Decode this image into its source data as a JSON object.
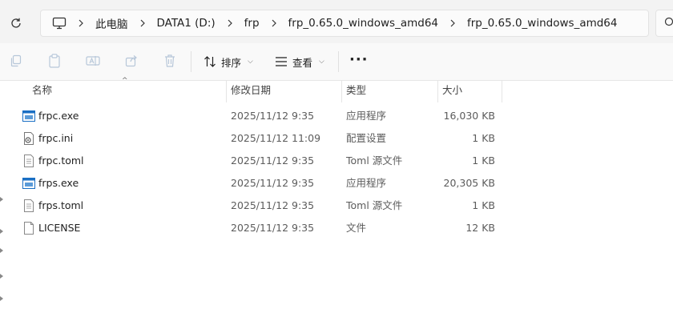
{
  "address": {
    "crumbs": [
      "此电脑",
      "DATA1 (D:)",
      "frp",
      "frp_0.65.0_windows_amd64",
      "frp_0.65.0_windows_amd64"
    ]
  },
  "toolbar": {
    "sort_label": "排序",
    "view_label": "查看",
    "more_label": "···"
  },
  "columns": {
    "name": "名称",
    "modified": "修改日期",
    "type": "类型",
    "size": "大小"
  },
  "files": [
    {
      "name": "frpc.exe",
      "modified": "2025/11/12 9:35",
      "type": "应用程序",
      "size": "16,030 KB",
      "icon": "exe-icon"
    },
    {
      "name": "frpc.ini",
      "modified": "2025/11/12 11:09",
      "type": "配置设置",
      "size": "1 KB",
      "icon": "settings-file-icon"
    },
    {
      "name": "frpc.toml",
      "modified": "2025/11/12 9:35",
      "type": "Toml 源文件",
      "size": "1 KB",
      "icon": "text-file-icon"
    },
    {
      "name": "frps.exe",
      "modified": "2025/11/12 9:35",
      "type": "应用程序",
      "size": "20,305 KB",
      "icon": "exe-icon"
    },
    {
      "name": "frps.toml",
      "modified": "2025/11/12 9:35",
      "type": "Toml 源文件",
      "size": "1 KB",
      "icon": "text-file-icon"
    },
    {
      "name": "LICENSE",
      "modified": "2025/11/12 9:35",
      "type": "文件",
      "size": "12 KB",
      "icon": "blank-file-icon"
    }
  ],
  "colors": {
    "accent": "#0067c0",
    "exe_blue": "#1a6fc4",
    "disabled_icon": "#b7c7d9"
  }
}
